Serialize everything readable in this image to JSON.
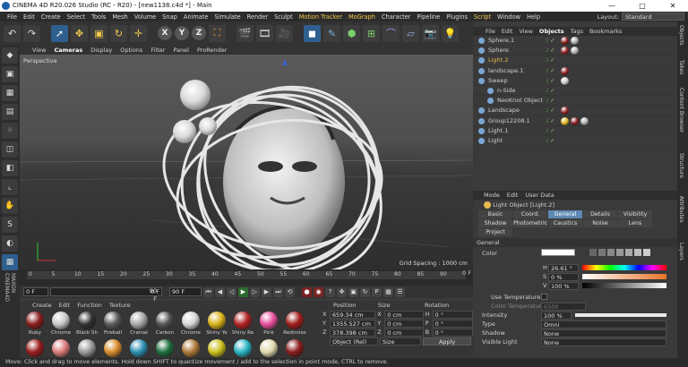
{
  "window": {
    "title": "CINEMA 4D R20.026 Studio (RC - R20) - [new1138.c4d *] - Main",
    "controls": [
      "—",
      "□",
      "✕"
    ]
  },
  "menubar": {
    "items": [
      "File",
      "Edit",
      "Create",
      "Select",
      "Tools",
      "Mesh",
      "Volume",
      "Snap",
      "Animate",
      "Simulate",
      "Render",
      "Sculpt",
      "Motion Tracker",
      "MoGraph",
      "Character",
      "Pipeline",
      "Plugins",
      "Script",
      "Window",
      "Help"
    ],
    "layout_label": "Layout:",
    "layout_value": "Standard"
  },
  "toolbar": {
    "xyz": [
      "X",
      "Y",
      "Z"
    ]
  },
  "viewport": {
    "menu": [
      "View",
      "Cameras",
      "Display",
      "Options",
      "Filter",
      "Panel",
      "ProRender"
    ],
    "label": "Perspective",
    "grid_spacing": "Grid Spacing : 1000 cm"
  },
  "timeline": {
    "ticks": [
      "0",
      "5",
      "10",
      "15",
      "20",
      "25",
      "30",
      "35",
      "40",
      "45",
      "50",
      "55",
      "60",
      "65",
      "70",
      "75",
      "80",
      "85",
      "90"
    ],
    "end_label": "0 F"
  },
  "transport": {
    "start_frame": "0 F",
    "current_frame": "0 F",
    "end_frame": "90 F",
    "max_frame": "90 F"
  },
  "materials": {
    "menu": [
      "Create",
      "Edit",
      "Function",
      "Texture"
    ],
    "row1": [
      {
        "name": "Ruby",
        "color": "#8a1d1d"
      },
      {
        "name": "Chrome",
        "color": "#c8c8c8"
      },
      {
        "name": "Black Sh",
        "color": "#333333"
      },
      {
        "name": "Fireball",
        "color": "#5c5c5c"
      },
      {
        "name": "Cranial",
        "color": "#a7a7a7"
      },
      {
        "name": "Carbon",
        "color": "#555555"
      },
      {
        "name": "Chrome",
        "color": "#d5d5d5"
      },
      {
        "name": "Shiny Ye",
        "color": "#d9b21a"
      },
      {
        "name": "Shiny Re",
        "color": "#b32222"
      },
      {
        "name": "Pink",
        "color": "#e64f9b"
      },
      {
        "name": "Rednoise",
        "color": "#a31d1d"
      }
    ],
    "row2": [
      {
        "name": "",
        "color": "#9a1d1d"
      },
      {
        "name": "",
        "color": "#d97a7a"
      },
      {
        "name": "",
        "color": "#9a9a9a"
      },
      {
        "name": "",
        "color": "#d98c2c"
      },
      {
        "name": "",
        "color": "#2c8fb3"
      },
      {
        "name": "",
        "color": "#1f6f3f"
      },
      {
        "name": "",
        "color": "#b07a3a"
      },
      {
        "name": "",
        "color": "#ccc01c"
      },
      {
        "name": "",
        "color": "#2ab3c4"
      },
      {
        "name": "",
        "color": "#e0d9b0"
      },
      {
        "name": "",
        "color": "#8a1d1d"
      }
    ]
  },
  "coordinates": {
    "headers": [
      "Position",
      "Size",
      "Rotation"
    ],
    "rows": [
      {
        "axis": "X",
        "pos": "659.34 cm",
        "size": "0 cm",
        "rot_axis": "H",
        "rot": "0 °"
      },
      {
        "axis": "Y",
        "pos": "1355.527 cm",
        "size": "0 cm",
        "rot_axis": "P",
        "rot": "0 °"
      },
      {
        "axis": "Z",
        "pos": "378.398 cm",
        "size": "0 cm",
        "rot_axis": "B",
        "rot": "0 °"
      }
    ],
    "mode": "Object (Rel)",
    "size_mode": "Size",
    "apply": "Apply"
  },
  "status": "Move: Click and drag to move elements. Hold down SHIFT to quantize movement / add to the selection in point mode, CTRL to remove.",
  "objects": {
    "tabs": [
      "File",
      "Edit",
      "View",
      "Objects",
      "Tags",
      "Bookmarks"
    ],
    "items": [
      {
        "name": "Sphere.1",
        "indent": 0,
        "color": "#cfcfcf",
        "tags": [
          "#8a1d1d",
          "#aaaaaa"
        ]
      },
      {
        "name": "Sphere",
        "indent": 0,
        "color": "#cfcfcf",
        "tags": [
          "#8a1d1d",
          "#aaaaaa"
        ]
      },
      {
        "name": "Light.2",
        "indent": 0,
        "color": "#e8b94f",
        "tags": []
      },
      {
        "name": "landscape.1",
        "indent": 0,
        "color": "#cfcfcf",
        "tags": [
          "#8a1d1d"
        ]
      },
      {
        "name": "Sweep",
        "indent": 0,
        "color": "#cfcfcf",
        "tags": [
          "#c8c8c8"
        ]
      },
      {
        "name": "n-Side",
        "indent": 1,
        "color": "#cfcfcf",
        "tags": []
      },
      {
        "name": "NeoKnot Object",
        "indent": 1,
        "color": "#cfcfcf",
        "tags": []
      },
      {
        "name": "Landscape",
        "indent": 0,
        "color": "#cfcfcf",
        "tags": [
          "#8a1d1d"
        ]
      },
      {
        "name": "Group12208.1",
        "indent": 0,
        "color": "#cfcfcf",
        "tags": [
          "#d9b21a",
          "#8a1d1d",
          "#aaaaaa"
        ]
      },
      {
        "name": "Light.1",
        "indent": 0,
        "color": "#cfcfcf",
        "tags": []
      },
      {
        "name": "Light",
        "indent": 0,
        "color": "#cfcfcf",
        "tags": []
      }
    ]
  },
  "attributes": {
    "menu": [
      "Mode",
      "Edit",
      "User Data"
    ],
    "title": "Light Object [Light.2]",
    "tabs": [
      "Basic",
      "Coord.",
      "General",
      "Details",
      "Visibility",
      "Shadow",
      "Photometric",
      "Caustics",
      "Noise",
      "Lens",
      "Project"
    ],
    "active_tab": "General",
    "section": "General",
    "color_label": "Color",
    "h_label": "H",
    "h_value": "26.61 °",
    "s_label": "S",
    "s_value": "0 %",
    "v_label": "V",
    "v_value": "100 %",
    "use_temp_label": "Use Temperature",
    "color_temp_label": "Color Temperature",
    "color_temp_value": "6500",
    "intensity_label": "Intensity",
    "intensity_value": "100 %",
    "type_label": "Type",
    "type_value": "Omni",
    "shadow_label": "Shadow",
    "shadow_value": "None",
    "visible_label": "Visible Light",
    "visible_value": "None"
  },
  "right_strip": [
    "Objects",
    "Takes",
    "Content Browser",
    "Structure",
    "Attributes",
    "Layers"
  ]
}
